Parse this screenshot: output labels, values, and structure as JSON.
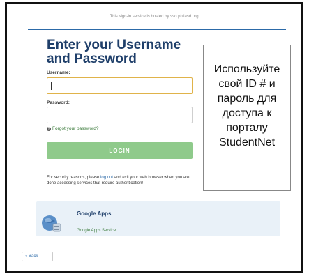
{
  "header": {
    "hosted_text": "This sign-in service is hosted by sso.philasd.org"
  },
  "form": {
    "title_line1": "Enter your Username",
    "title_line2": "and Password",
    "username_label": "Username:",
    "username_value": "",
    "password_label": "Password:",
    "password_value": "",
    "forgot_link": "Forgot your password?",
    "login_button": "LOGIN",
    "security_note_before": "For security reasons, please ",
    "security_note_link": "log out",
    "security_note_after": " and exit your web browser when you are done accessing services that require authentication!"
  },
  "callout": {
    "text": "Используйте свой ID # и пароль для доступа к порталу StudentNet"
  },
  "service": {
    "title": "Google Apps",
    "subtitle": "Google Apps Service",
    "icon": "google-apps-globe-icon"
  },
  "nav": {
    "back_label": "Back",
    "back_icon": "chevron-left-icon"
  },
  "colors": {
    "title": "#1f3f6a",
    "login_button": "#8fca8b",
    "link_green": "#3a7a3a",
    "link_blue": "#2c6aa8",
    "focus_border": "#e0b34a",
    "service_panel": "#e9f1f8"
  }
}
